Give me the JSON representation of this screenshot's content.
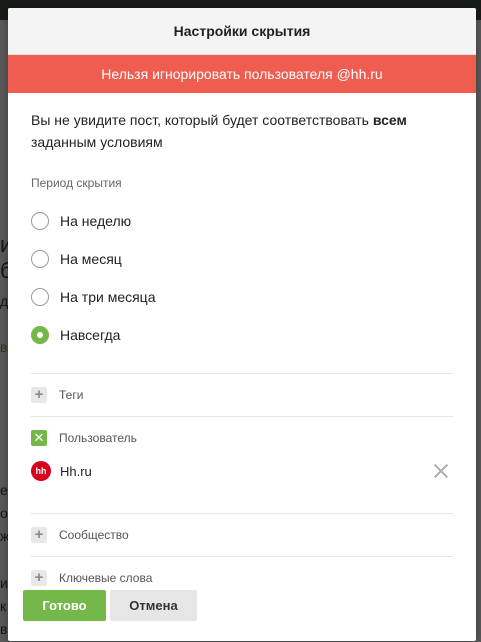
{
  "background": {
    "fragments": [
      "и",
      "б",
      "д",
      "в",
      "е",
      "о",
      "ж",
      "и",
      "к",
      "в"
    ]
  },
  "modal": {
    "title": "Настройки скрытия",
    "alert": "Нельзя игнорировать пользователя @hh.ru",
    "intro_before": "Вы не увидите пост, который будет соответствовать ",
    "intro_bold": "всем",
    "intro_after": " заданным условиям",
    "period": {
      "label": "Период скрытия",
      "options": [
        {
          "label": "На неделю",
          "checked": false
        },
        {
          "label": "На месяц",
          "checked": false
        },
        {
          "label": "На три месяца",
          "checked": false
        },
        {
          "label": "Навсегда",
          "checked": true
        }
      ]
    },
    "filters": {
      "tags": {
        "label": "Теги",
        "icon": "plus-icon"
      },
      "user": {
        "label": "Пользователь",
        "icon": "close-icon",
        "entry": {
          "logo_text": "hh",
          "name": "Hh.ru"
        }
      },
      "community": {
        "label": "Сообщество",
        "icon": "plus-icon"
      },
      "keywords": {
        "label": "Ключевые слова",
        "icon": "plus-icon"
      }
    },
    "buttons": {
      "submit": "Готово",
      "cancel": "Отмена"
    }
  },
  "colors": {
    "accent": "#75b84a",
    "alert": "#ee5d4f",
    "brand_hh": "#d6001c"
  }
}
